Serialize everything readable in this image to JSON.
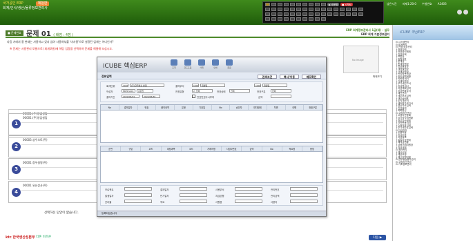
{
  "header": {
    "line1": "국가공인 ERP",
    "line2": "회계/인사/생산/물류정보관리사",
    "badge": "체험판",
    "exam_id": "A1403",
    "tools": [
      "드라인",
      "바로가기",
      "바로가기"
    ],
    "ctrl": {
      "btn1": "▶ 소문제",
      "btn2": "■ 시작됨"
    },
    "status": [
      {
        "icon": "bell",
        "text": "남은시간"
      },
      {
        "icon": "clock",
        "text": "미제1:20:0"
      },
      {
        "icon": "user",
        "text": "수험번호"
      }
    ]
  },
  "question": {
    "tag": "■ 문제번호",
    "label": "문제",
    "number": "01",
    "score": "( 배점 : 4점 )",
    "right1": "ERP 회계정보관리사 1급(대) - 실무",
    "right2": "ERP 회계 기본정보관리",
    "text": "다음 거래처 중 현재는 사용하고 있지 않아 사용여부를 '미사용'으로 설정된 업체는 어디인가?",
    "note": "※ 문제는 사용관리 모듈으로 (회계모듈)에 해당 업장을 선택하여 문제를 해결해 보십시오.",
    "image_label": "No Image",
    "zoom_label": "확대보기"
  },
  "subject_label": "00001.(주)영업설립",
  "options": [
    {
      "num": "1",
      "text": "00001.(주)영업설립"
    },
    {
      "num": "2",
      "text": "00003.성우오토(주)"
    },
    {
      "num": "3",
      "text": "00001.정우설명(주)"
    },
    {
      "num": "4",
      "text": "00001.유신상사(주)"
    }
  ],
  "footer": {
    "message": "선택하신 답안이 없습니다.",
    "logo": "ktc 한국생산성본부",
    "logo2": "더존 비즈온",
    "next": "다음 ▶"
  },
  "right_panel": {
    "title": "iCUBE 핵심ERP",
    "tree": [
      "⊟ 시스템관리",
      "⊟ 회계관리",
      "⊟ 전표/장부관리",
      "  ├ 전표입력",
      "  ├ 전표승인해제",
      "  ├ 전표조회",
      "  ├ 보통장",
      "  ├ 일월계표",
      "  ├ 분개장",
      "  ├ 총계정원장",
      "  ├ 현금출납장",
      "  ├ 계정별원장",
      "  ├ 거래처원장",
      "  ├ 관리항목원장",
      "  ├ 관리내역현황",
      "  ├ 외화명세서",
      "  ├ 거래처원장",
      "  ├ 부가세신고서",
      "  ├ 지급명세서",
      "  ├ 자금계획입력",
      "  ├ 자금현황분석",
      "  ├ 예산관리",
      "  ├ 세무보조입력",
      "  ├ 재무상태표",
      "  ├ 손익계산서",
      "  ├ 제조원가보고서",
      "  ├ 결산자료입력",
      "  ├ 전표출력",
      "  ├ 외화환산",
      "⊟ 고정자산관리",
      "  ├ 고정자산등록",
      "  ├ 감가상각비현황",
      "  ├ 처분자산명세",
      "  ├ 자산변동처리",
      "  ├ 수정전표입력",
      "  ├ 부가세자료입력",
      "⊟ 자금관리",
      "  ├ 받을어음",
      "  ├ 지급어음",
      "  ├ 자금일보",
      "  ├ 일일자금명세",
      "  ├ 예적금현황",
      "  ├ 금융거래처원장",
      "  ├ 자금계획",
      "⊟ 예산관리",
      "  ├ 예산신청",
      "  ├ 예산조정",
      "  ├ 예산집행현황",
      "⊟ 업무용승용차관리",
      "⊟ 고정자산관리",
      "⊟ 기초정보관리"
    ]
  },
  "erp": {
    "brand": "iCUBE 핵심ERP",
    "toolbar": [
      "조회",
      "코드도움",
      "삭제",
      "인쇄",
      "종료"
    ],
    "screen_title": "전표입력",
    "top_buttons": [
      "검색조건",
      "복사/이동",
      "메모확인"
    ],
    "fields": {
      "unit_label": "회계단위",
      "unit_code": "1000",
      "unit_value": "(주)한국생산 본점",
      "dept_label": "결의부서",
      "dept_code": "1001",
      "dept_value": "재경팀",
      "writer_label": "작성자",
      "writer_code": "ERP13A01",
      "writer_value": "김은진",
      "period_label": "결의기간",
      "period_from": "2022/06/01",
      "period_to": "2022/06/30",
      "status_label": "전표상태",
      "status_value": "전체",
      "type_label": "전표구분",
      "type_value": "전체",
      "cust_label": "전표유형",
      "cust_value": "2. 전체",
      "amount_label": "금액",
      "check_label": "전표번호다시부여"
    },
    "grid1_headers": [
      "No",
      "결의일자",
      "번호",
      "품의내역",
      "유형",
      "기표일",
      "No",
      "승인자",
      "대차합계",
      "차변",
      "대변",
      "전표구분"
    ],
    "grid2_headers": [
      "순번",
      "구분",
      "코드",
      "계정과목",
      "코드",
      "거래처명",
      "사업자번호",
      "금액",
      "No",
      "적요명",
      "증빙"
    ],
    "bottom": [
      "프로젝트",
      "결재일자",
      "사용부서",
      "관리번호",
      "발생일자",
      "만기일자",
      "지급은행",
      "관리금액",
      "관리율",
      "적요",
      "사원명",
      "사용자"
    ],
    "status": "등록되었습니다"
  }
}
